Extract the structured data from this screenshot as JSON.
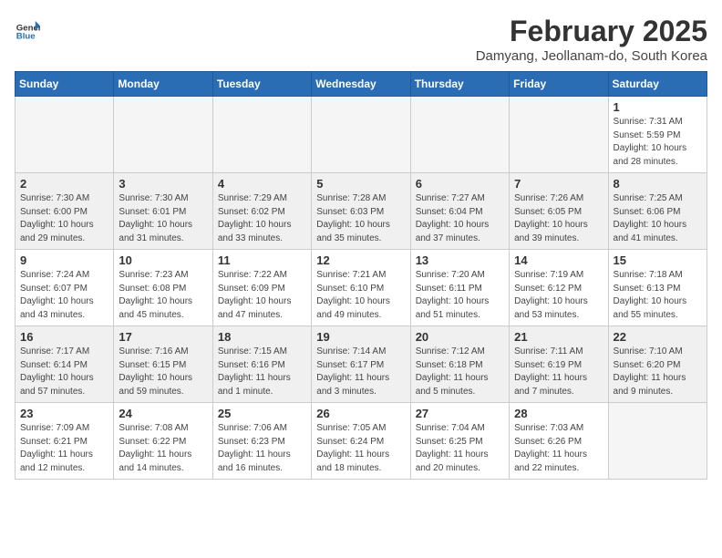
{
  "header": {
    "logo_general": "General",
    "logo_blue": "Blue",
    "month_title": "February 2025",
    "location": "Damyang, Jeollanam-do, South Korea"
  },
  "days_of_week": [
    "Sunday",
    "Monday",
    "Tuesday",
    "Wednesday",
    "Thursday",
    "Friday",
    "Saturday"
  ],
  "weeks": [
    [
      {
        "day": "",
        "info": ""
      },
      {
        "day": "",
        "info": ""
      },
      {
        "day": "",
        "info": ""
      },
      {
        "day": "",
        "info": ""
      },
      {
        "day": "",
        "info": ""
      },
      {
        "day": "",
        "info": ""
      },
      {
        "day": "1",
        "info": "Sunrise: 7:31 AM\nSunset: 5:59 PM\nDaylight: 10 hours\nand 28 minutes."
      }
    ],
    [
      {
        "day": "2",
        "info": "Sunrise: 7:30 AM\nSunset: 6:00 PM\nDaylight: 10 hours\nand 29 minutes."
      },
      {
        "day": "3",
        "info": "Sunrise: 7:30 AM\nSunset: 6:01 PM\nDaylight: 10 hours\nand 31 minutes."
      },
      {
        "day": "4",
        "info": "Sunrise: 7:29 AM\nSunset: 6:02 PM\nDaylight: 10 hours\nand 33 minutes."
      },
      {
        "day": "5",
        "info": "Sunrise: 7:28 AM\nSunset: 6:03 PM\nDaylight: 10 hours\nand 35 minutes."
      },
      {
        "day": "6",
        "info": "Sunrise: 7:27 AM\nSunset: 6:04 PM\nDaylight: 10 hours\nand 37 minutes."
      },
      {
        "day": "7",
        "info": "Sunrise: 7:26 AM\nSunset: 6:05 PM\nDaylight: 10 hours\nand 39 minutes."
      },
      {
        "day": "8",
        "info": "Sunrise: 7:25 AM\nSunset: 6:06 PM\nDaylight: 10 hours\nand 41 minutes."
      }
    ],
    [
      {
        "day": "9",
        "info": "Sunrise: 7:24 AM\nSunset: 6:07 PM\nDaylight: 10 hours\nand 43 minutes."
      },
      {
        "day": "10",
        "info": "Sunrise: 7:23 AM\nSunset: 6:08 PM\nDaylight: 10 hours\nand 45 minutes."
      },
      {
        "day": "11",
        "info": "Sunrise: 7:22 AM\nSunset: 6:09 PM\nDaylight: 10 hours\nand 47 minutes."
      },
      {
        "day": "12",
        "info": "Sunrise: 7:21 AM\nSunset: 6:10 PM\nDaylight: 10 hours\nand 49 minutes."
      },
      {
        "day": "13",
        "info": "Sunrise: 7:20 AM\nSunset: 6:11 PM\nDaylight: 10 hours\nand 51 minutes."
      },
      {
        "day": "14",
        "info": "Sunrise: 7:19 AM\nSunset: 6:12 PM\nDaylight: 10 hours\nand 53 minutes."
      },
      {
        "day": "15",
        "info": "Sunrise: 7:18 AM\nSunset: 6:13 PM\nDaylight: 10 hours\nand 55 minutes."
      }
    ],
    [
      {
        "day": "16",
        "info": "Sunrise: 7:17 AM\nSunset: 6:14 PM\nDaylight: 10 hours\nand 57 minutes."
      },
      {
        "day": "17",
        "info": "Sunrise: 7:16 AM\nSunset: 6:15 PM\nDaylight: 10 hours\nand 59 minutes."
      },
      {
        "day": "18",
        "info": "Sunrise: 7:15 AM\nSunset: 6:16 PM\nDaylight: 11 hours\nand 1 minute."
      },
      {
        "day": "19",
        "info": "Sunrise: 7:14 AM\nSunset: 6:17 PM\nDaylight: 11 hours\nand 3 minutes."
      },
      {
        "day": "20",
        "info": "Sunrise: 7:12 AM\nSunset: 6:18 PM\nDaylight: 11 hours\nand 5 minutes."
      },
      {
        "day": "21",
        "info": "Sunrise: 7:11 AM\nSunset: 6:19 PM\nDaylight: 11 hours\nand 7 minutes."
      },
      {
        "day": "22",
        "info": "Sunrise: 7:10 AM\nSunset: 6:20 PM\nDaylight: 11 hours\nand 9 minutes."
      }
    ],
    [
      {
        "day": "23",
        "info": "Sunrise: 7:09 AM\nSunset: 6:21 PM\nDaylight: 11 hours\nand 12 minutes."
      },
      {
        "day": "24",
        "info": "Sunrise: 7:08 AM\nSunset: 6:22 PM\nDaylight: 11 hours\nand 14 minutes."
      },
      {
        "day": "25",
        "info": "Sunrise: 7:06 AM\nSunset: 6:23 PM\nDaylight: 11 hours\nand 16 minutes."
      },
      {
        "day": "26",
        "info": "Sunrise: 7:05 AM\nSunset: 6:24 PM\nDaylight: 11 hours\nand 18 minutes."
      },
      {
        "day": "27",
        "info": "Sunrise: 7:04 AM\nSunset: 6:25 PM\nDaylight: 11 hours\nand 20 minutes."
      },
      {
        "day": "28",
        "info": "Sunrise: 7:03 AM\nSunset: 6:26 PM\nDaylight: 11 hours\nand 22 minutes."
      },
      {
        "day": "",
        "info": ""
      }
    ]
  ]
}
